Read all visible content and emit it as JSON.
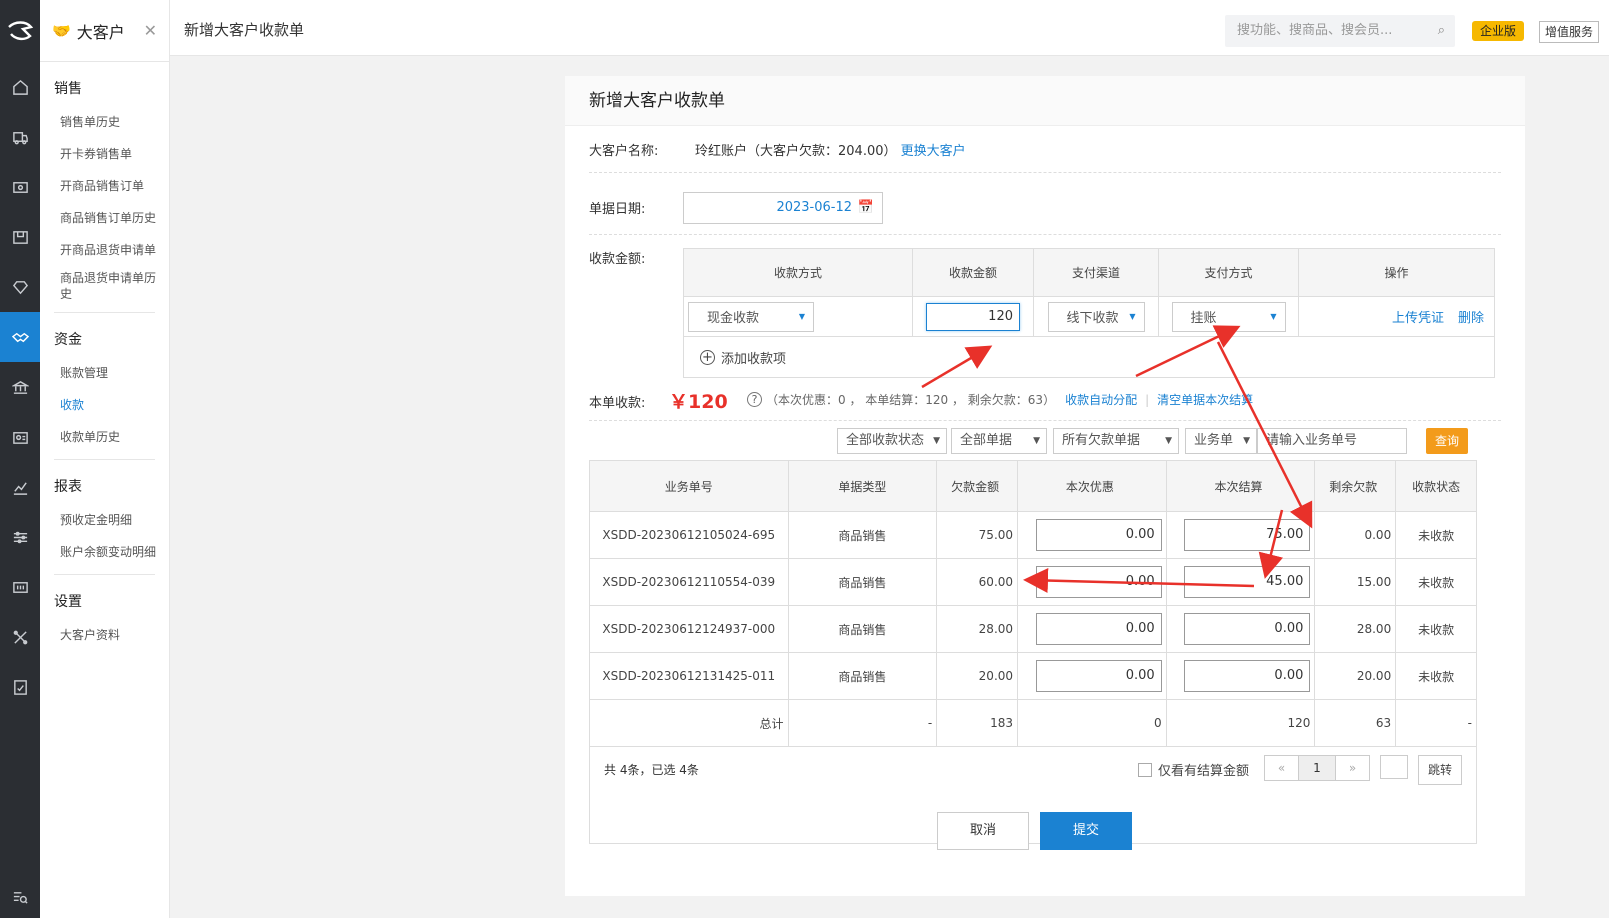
{
  "sidebar": {
    "title": "大客户",
    "sections": [
      {
        "name": "销售",
        "items": [
          "销售单历史",
          "开卡券销售单",
          "开商品销售订单",
          "商品销售订单历史",
          "开商品退货申请单",
          "商品退货申请单历史"
        ]
      },
      {
        "name": "资金",
        "items": [
          "账款管理",
          "收款",
          "收款单历史"
        ]
      },
      {
        "name": "报表",
        "items": [
          "预收定金明细",
          "账户余额变动明细"
        ]
      },
      {
        "name": "设置",
        "items": [
          "大客户资料"
        ]
      }
    ],
    "active_item": "收款"
  },
  "topbar": {
    "page_title": "新增大客户收款单",
    "search_placeholder": "搜功能、搜商品、搜会员...",
    "edition_badge": "企业版",
    "vas_button": "增值服务"
  },
  "form": {
    "title": "新增大客户收款单",
    "customer_label": "大客户名称:",
    "customer_value": "玲红账户（大客户欠款：204.00）",
    "change_customer_link": "更换大客户",
    "date_label": "单据日期:",
    "date_value": "2023-06-12",
    "amount_label": "收款金额:",
    "pay_table": {
      "headers": [
        "收款方式",
        "收款金额",
        "支付渠道",
        "支付方式",
        "操作"
      ],
      "row": {
        "method": "现金收款",
        "amount": "120",
        "channel": "线下收款",
        "pay_way": "挂账",
        "upload": "上传凭证",
        "delete": "删除"
      },
      "add_label": "添加收款项"
    },
    "this_label": "本单收款:",
    "this_amount": "￥120",
    "summary": "（本次优惠：0 ， 本单结算：120 ， 剩余欠款：63）",
    "auto_alloc": "收款自动分配",
    "clear_link": "清空单据本次结算"
  },
  "filters": {
    "status": "全部收款状态",
    "docs": "全部单据",
    "debts": "所有欠款单据",
    "biz": "业务单",
    "input_placeholder": "请输入业务单号",
    "query": "查询"
  },
  "table": {
    "headers": [
      "业务单号",
      "单据类型",
      "欠款金额",
      "本次优惠",
      "本次结算",
      "剩余欠款",
      "收款状态"
    ],
    "rows": [
      {
        "no": "XSDD-20230612105024-695",
        "type": "商品销售",
        "debt": "75.00",
        "discount": "0.00",
        "settle": "75.00",
        "remain": "0.00",
        "status": "未收款"
      },
      {
        "no": "XSDD-20230612110554-039",
        "type": "商品销售",
        "debt": "60.00",
        "discount": "0.00",
        "settle": "45.00",
        "remain": "15.00",
        "status": "未收款"
      },
      {
        "no": "XSDD-20230612124937-000",
        "type": "商品销售",
        "debt": "28.00",
        "discount": "0.00",
        "settle": "0.00",
        "remain": "28.00",
        "status": "未收款"
      },
      {
        "no": "XSDD-20230612131425-011",
        "type": "商品销售",
        "debt": "20.00",
        "discount": "0.00",
        "settle": "0.00",
        "remain": "20.00",
        "status": "未收款"
      }
    ],
    "total": {
      "label": "总计",
      "type": "-",
      "debt": "183",
      "discount": "0",
      "settle": "120",
      "remain": "63",
      "status": "-"
    },
    "count_text": "共 4条，已选 4条",
    "only_settled": "仅看有结算金额",
    "pager": {
      "prev": "«",
      "current": "1",
      "next": "»",
      "jump": "跳转"
    }
  },
  "buttons": {
    "cancel": "取消",
    "submit": "提交"
  },
  "colors": {
    "accent": "#1b82d2",
    "amount_red": "#e8312a",
    "query_orange": "#f39b1b",
    "badge_yellow": "#f6b800",
    "arrow_red": "#e8312a"
  }
}
